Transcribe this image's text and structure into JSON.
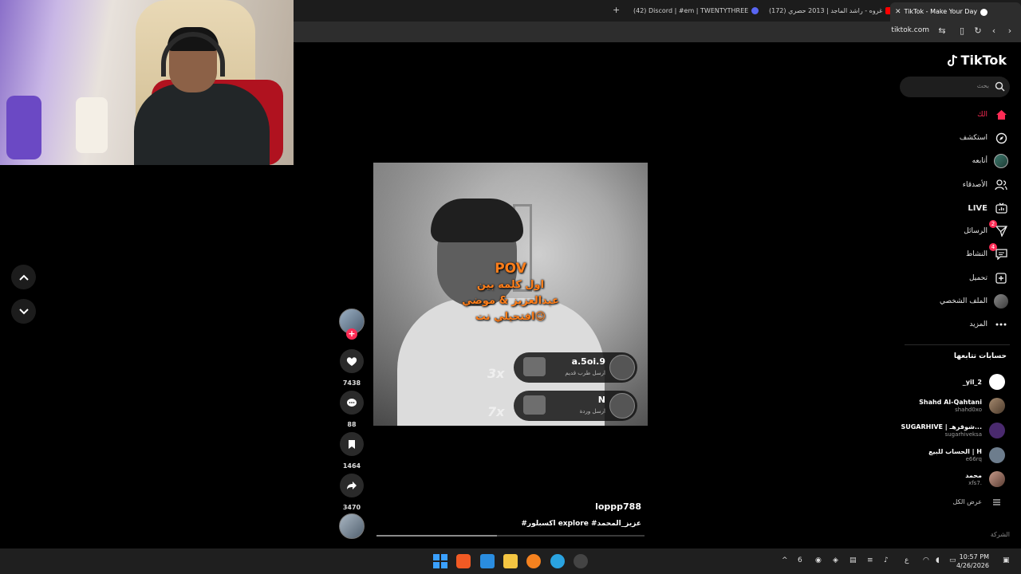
{
  "browser": {
    "tabs": [
      {
        "label": "(42) Discord | #em | TWENTYTHREE",
        "color": "#5865f2"
      },
      {
        "label": "(172) غروه - راشد الماجد | 2013 حصري",
        "color": "#ff0000"
      },
      {
        "label": "TikTok - Make Your Day",
        "color": "#ffffff"
      }
    ],
    "url": "tiktok.com"
  },
  "video": {
    "overlay_lines": [
      "POV",
      "اول كلمه بين",
      "عبدالعزيز & موضي",
      "افتحيلي نت😉"
    ],
    "gifts": [
      {
        "name": "a.5oi.9",
        "sub": "ارسل طرب قديم",
        "count": "3x"
      },
      {
        "name": "N",
        "sub": "ارسل وردة",
        "count": "7x"
      }
    ],
    "author": "loppp788",
    "caption": "#اكسبلور explore #عزيز_المحمد",
    "progress": 0.45
  },
  "actions": {
    "likes": "7438",
    "comments": "88",
    "saves": "1464",
    "shares": "3470"
  },
  "sidebar": {
    "logo": "TikTok",
    "search_placeholder": "بحث",
    "items": [
      {
        "label": "الك",
        "icon": "home-icon",
        "active": true
      },
      {
        "label": "استكشف",
        "icon": "compass-icon"
      },
      {
        "label": "أتابعه",
        "icon": "avatar-icon"
      },
      {
        "label": "الأصدقاء",
        "icon": "friends-icon"
      },
      {
        "label": "LIVE",
        "icon": "live-icon"
      },
      {
        "label": "الرسائل",
        "icon": "messages-icon",
        "badge": "2"
      },
      {
        "label": "النشاط",
        "icon": "activity-icon",
        "badge": "4"
      },
      {
        "label": "تحميل",
        "icon": "upload-icon"
      },
      {
        "label": "الملف الشخصي",
        "icon": "profile-icon"
      },
      {
        "label": "المزيد",
        "icon": "more-icon"
      }
    ],
    "following_title": "حسابات تتابعها",
    "accounts": [
      {
        "name": "_yil_2",
        "handle": ""
      },
      {
        "name": "Shahd Al-Qahtani",
        "handle": "shahd0xo"
      },
      {
        "name": "SUGARHIVE | شوقرهـ...",
        "handle": "sugarhiveksa"
      },
      {
        "name": "الحساب للبيع | H",
        "handle": "e66rq"
      },
      {
        "name": "محمد",
        "handle": "xfs7."
      }
    ],
    "see_all": "عرض الكل",
    "company": "الشركة"
  },
  "taskbar": {
    "time": "10:57 PM",
    "date": "4/26/2026",
    "lang": "ع"
  },
  "colors": {
    "accent": "#fe2c55",
    "background": "#000000"
  }
}
